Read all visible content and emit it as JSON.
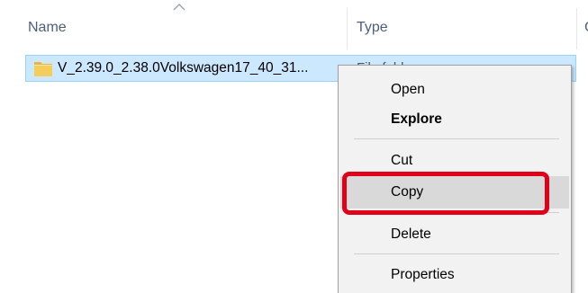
{
  "columns": {
    "name": "Name",
    "type": "Type",
    "next": "C"
  },
  "file": {
    "icon": "folder-icon",
    "name": "V_2.39.0_2.38.0Volkswagen17_40_31...",
    "type": "File folder"
  },
  "context_menu": {
    "items": [
      {
        "label": "Open",
        "bold": false
      },
      {
        "label": "Explore",
        "bold": true
      },
      {
        "label": "Cut",
        "bold": false
      },
      {
        "label": "Copy",
        "bold": false,
        "highlighted": true
      },
      {
        "label": "Delete",
        "bold": false
      },
      {
        "label": "Properties",
        "bold": false
      }
    ]
  },
  "colors": {
    "selection_fill": "#cce8ff",
    "selection_border": "#99d1ff",
    "menu_background": "#f2f2f2",
    "menu_hover": "#d9d9d9",
    "annotation": "#e0001a",
    "folder": "#f5cd5c"
  }
}
